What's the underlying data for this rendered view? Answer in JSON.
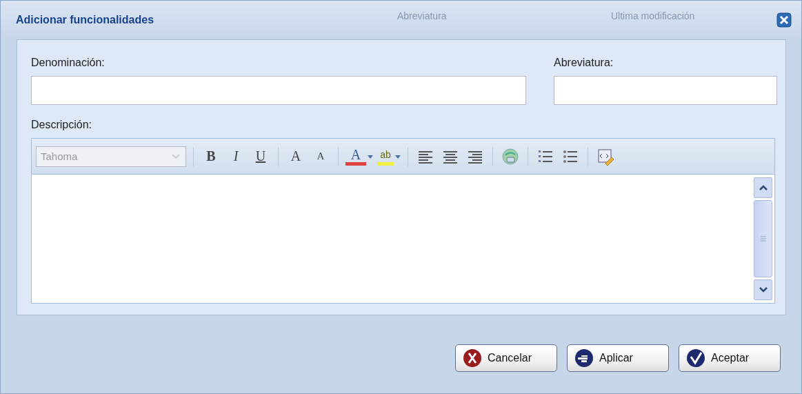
{
  "window": {
    "title": "Adicionar funcionalidades"
  },
  "background_headers": [
    "Abreviatura",
    "Ultima modificación"
  ],
  "fields": [
    {
      "label": "Denominación:"
    },
    {
      "label": "Abreviatura:"
    }
  ],
  "description": {
    "label": "Descripción:",
    "font_select": {
      "value": "Tahoma",
      "disabled": true
    },
    "toolbar_groups": [
      [
        {
          "kind": "bold",
          "glyph": "B"
        },
        {
          "kind": "italic",
          "glyph": "I"
        },
        {
          "kind": "underline",
          "glyph": "U"
        }
      ],
      [
        {
          "kind": "grow",
          "glyph": "A"
        },
        {
          "kind": "shrink",
          "glyph": "A"
        }
      ],
      [
        {
          "kind": "forecolor",
          "glyph": "A"
        },
        {
          "kind": "highlight",
          "glyph": "ab"
        }
      ],
      [
        {
          "kind": "align-left"
        },
        {
          "kind": "align-center"
        },
        {
          "kind": "align-right"
        }
      ],
      [
        {
          "kind": "link"
        }
      ],
      [
        {
          "kind": "ordered-list"
        },
        {
          "kind": "bullet-list"
        }
      ],
      [
        {
          "kind": "source"
        }
      ]
    ]
  },
  "buttons": [
    {
      "kind": "cancel",
      "label": "Cancelar"
    },
    {
      "kind": "apply",
      "label": "Aplicar"
    },
    {
      "kind": "accept",
      "label": "Aceptar"
    }
  ]
}
